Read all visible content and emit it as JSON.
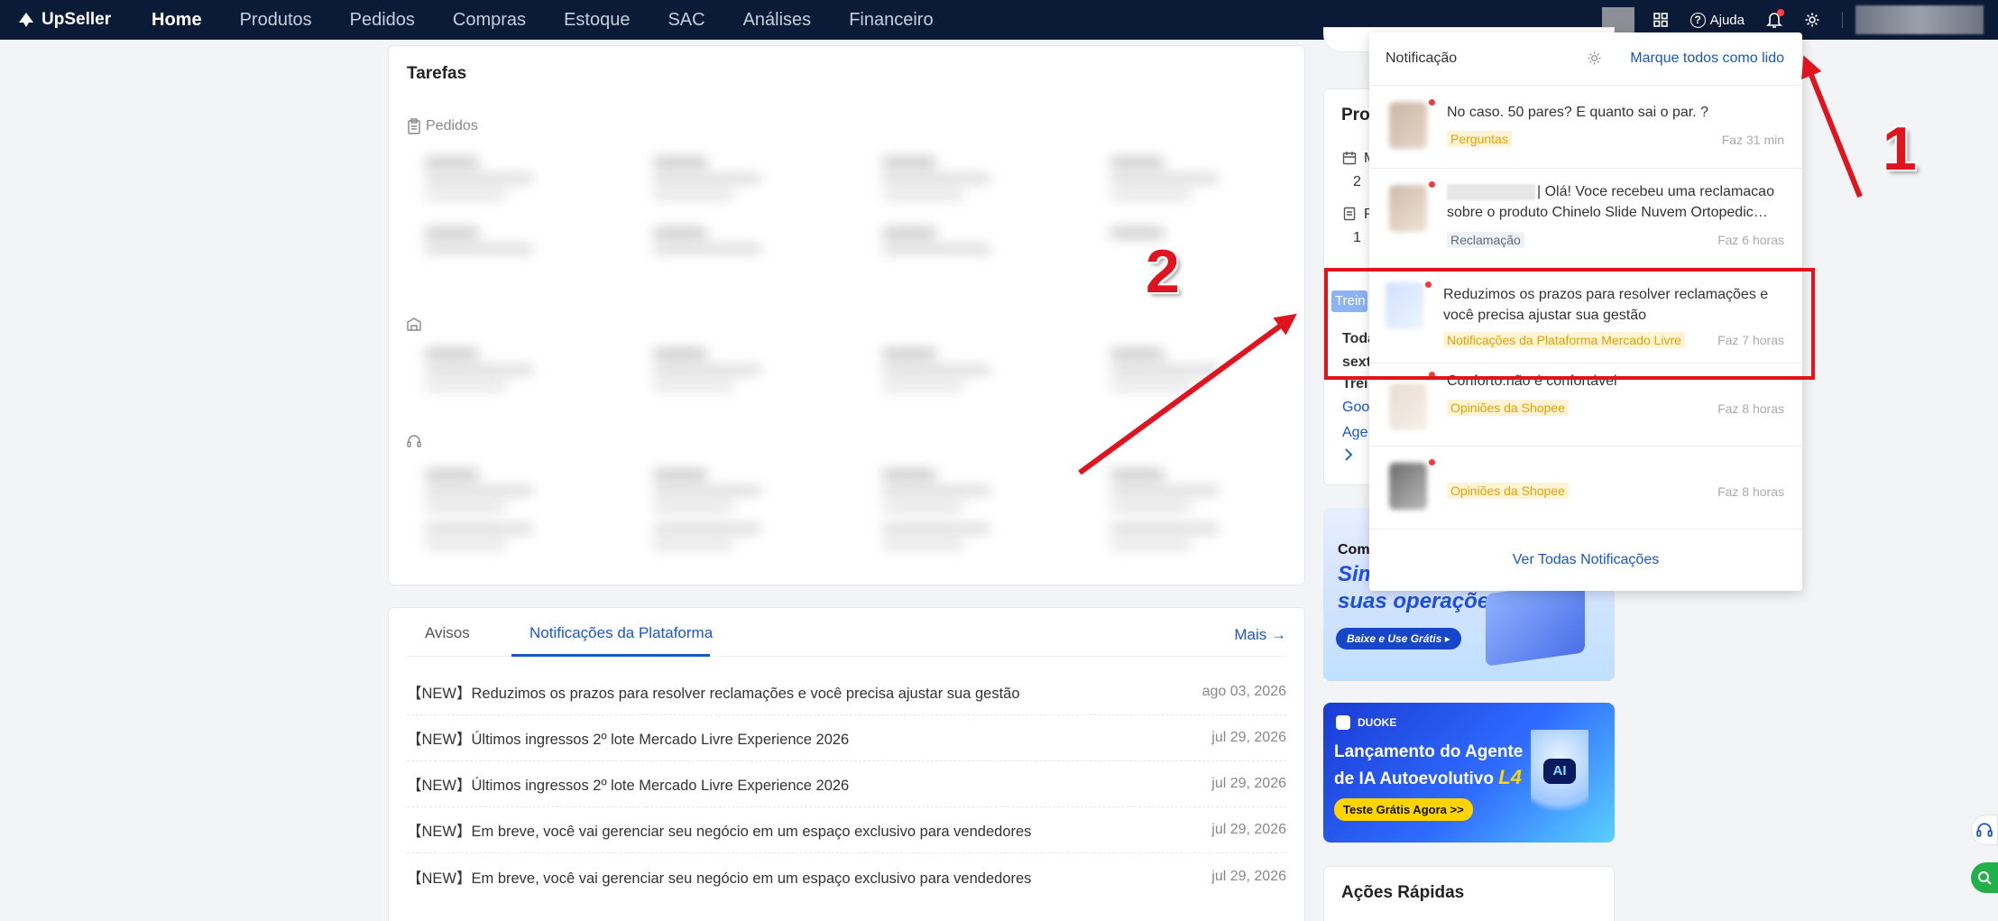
{
  "app": {
    "brand": "UpSeller"
  },
  "nav": {
    "items": [
      "Home",
      "Produtos",
      "Pedidos",
      "Compras",
      "Estoque",
      "SAC",
      "Análises",
      "Financeiro"
    ],
    "active": "Home",
    "help_label": "Ajuda"
  },
  "tasks": {
    "title": "Tarefas",
    "pedidos_label": "Pedidos"
  },
  "right": {
    "pro_title": "Pro",
    "treino_badge": "Trein",
    "frag1": "M",
    "frag1b": "2",
    "frag2": "P",
    "frag2b": "1",
    "frag3": "Toda",
    "frag4": "sext",
    "frag5": "Trei",
    "link1": "Goo",
    "link2": "Age",
    "ad1": {
      "com": "Com",
      "line1": "Sim",
      "line2": "suas operações",
      "btn": "Baixe e Use Grátis ▸"
    },
    "ad2": {
      "brand": "DUOKE",
      "line1": "Lançamento do Agente",
      "line2": "de IA Autoevolutivo",
      "line2_hl": "L4",
      "btn": "Teste Grátis Agora >>",
      "ai": "AI"
    },
    "quick_title": "Ações Rápidas"
  },
  "platform": {
    "tabs": [
      "Avisos",
      "Notificações da Plataforma"
    ],
    "active_tab": "Notificações da Plataforma",
    "more": "Mais →",
    "rows": [
      {
        "title": "【NEW】Reduzimos os prazos para resolver reclamações e você precisa ajustar sua gestão",
        "date": "ago 03, 2026"
      },
      {
        "title": "【NEW】Últimos ingressos 2º lote Mercado Livre Experience 2026",
        "date": "jul 29, 2026"
      },
      {
        "title": "【NEW】Últimos ingressos 2º lote Mercado Livre Experience 2026",
        "date": "jul 29, 2026"
      },
      {
        "title": "【NEW】Em breve, você vai gerenciar seu negócio em um espaço exclusivo para vendedores",
        "date": "jul 29, 2026"
      },
      {
        "title": "【NEW】Em breve, você vai gerenciar seu negócio em um espaço exclusivo para vendedores",
        "date": "jul 29, 2026"
      }
    ]
  },
  "popover": {
    "title": "Notificação",
    "mark_all": "Marque todos como lido",
    "footer": "Ver Todas Notificações",
    "items": [
      {
        "text": "No caso. 50 pares? E quanto sai o par. ?",
        "tag": "Perguntas",
        "time": "Faz 31 min"
      },
      {
        "text": "| Olá! Voce recebeu uma reclamacao sobre o produto Chinelo Slide Nuvem Ortopedic…",
        "tag": "Reclamação",
        "time": "Faz 6 horas"
      },
      {
        "text": "Reduzimos os prazos para resolver reclamações e você precisa ajustar sua gestão",
        "tag": "Notificações da Plataforma Mercado Livre",
        "time": "Faz 7 horas"
      },
      {
        "text": "Conforto:não é confortável",
        "tag": "Opiniões da Shopee",
        "time": "Faz 8 horas"
      },
      {
        "text": "",
        "tag": "Opiniões da Shopee",
        "time": "Faz 8 horas"
      }
    ]
  },
  "annotations": {
    "one": "1",
    "two": "2"
  },
  "colors": {
    "nav_bg": "#0b1a36",
    "accent": "#1a56c8",
    "annotation": "#e0141f"
  }
}
